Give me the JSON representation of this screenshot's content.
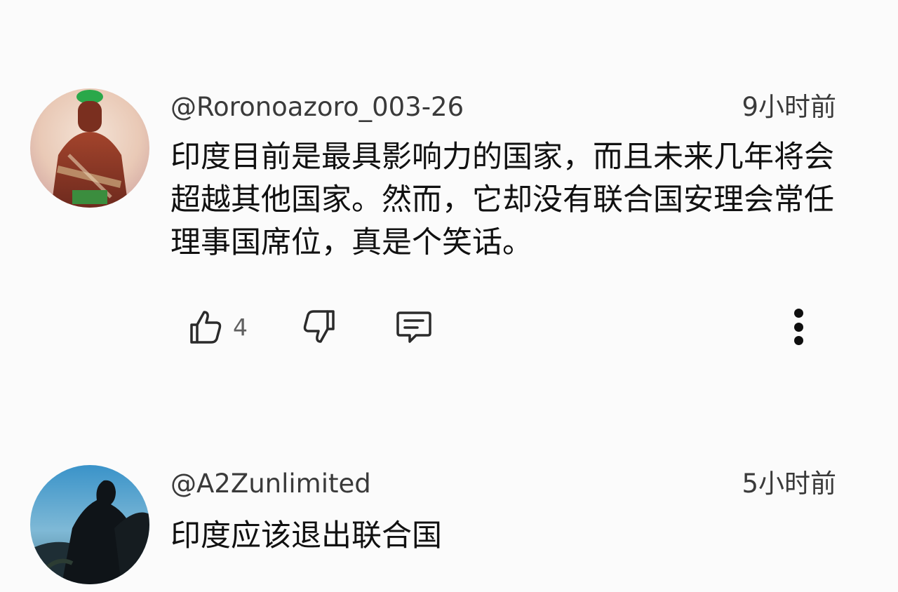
{
  "comments": [
    {
      "handle": "@Roronoazoro_003-26",
      "time": "9小时前",
      "text": "印度目前是最具影响力的国家，而且未来几年将会超越其他国家。然而，它却没有联合国安理会常任理事国席位，真是个笑话。",
      "likes": "4",
      "avatar_icon": "zoro-avatar"
    },
    {
      "handle": "@A2Zunlimited",
      "time": "5小时前",
      "text": "印度应该退出联合国",
      "avatar_icon": "silhouette-avatar"
    }
  ],
  "icons": {
    "like": "thumbs-up-icon",
    "dislike": "thumbs-down-icon",
    "reply": "comment-icon",
    "more": "more-vertical-icon"
  },
  "colors": {
    "background": "#fbfbfb",
    "text": "#0f0f0f",
    "secondary_text": "#3a3a3a",
    "count_text": "#606060"
  }
}
